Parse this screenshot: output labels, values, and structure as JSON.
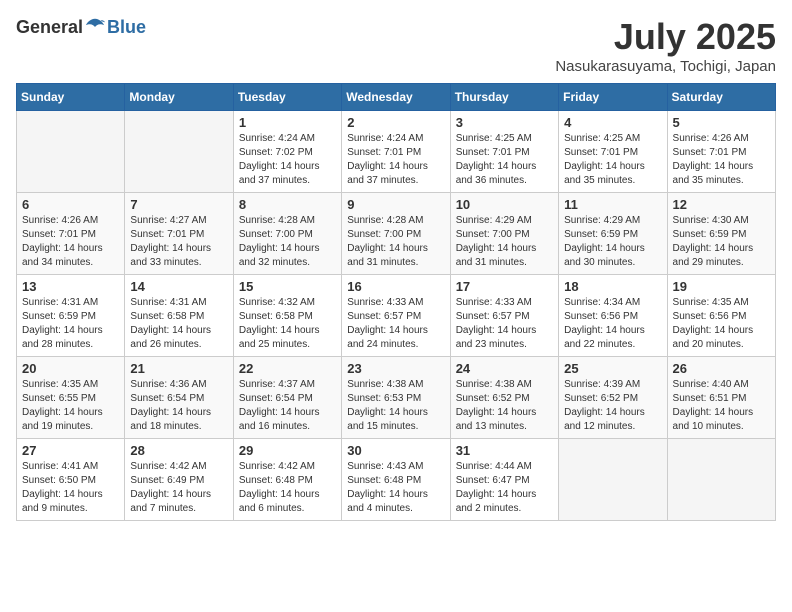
{
  "header": {
    "logo_general": "General",
    "logo_blue": "Blue",
    "month_title": "July 2025",
    "location": "Nasukarasuyama, Tochigi, Japan"
  },
  "weekdays": [
    "Sunday",
    "Monday",
    "Tuesday",
    "Wednesday",
    "Thursday",
    "Friday",
    "Saturday"
  ],
  "weeks": [
    [
      {
        "day": "",
        "detail": ""
      },
      {
        "day": "",
        "detail": ""
      },
      {
        "day": "1",
        "detail": "Sunrise: 4:24 AM\nSunset: 7:02 PM\nDaylight: 14 hours\nand 37 minutes."
      },
      {
        "day": "2",
        "detail": "Sunrise: 4:24 AM\nSunset: 7:01 PM\nDaylight: 14 hours\nand 37 minutes."
      },
      {
        "day": "3",
        "detail": "Sunrise: 4:25 AM\nSunset: 7:01 PM\nDaylight: 14 hours\nand 36 minutes."
      },
      {
        "day": "4",
        "detail": "Sunrise: 4:25 AM\nSunset: 7:01 PM\nDaylight: 14 hours\nand 35 minutes."
      },
      {
        "day": "5",
        "detail": "Sunrise: 4:26 AM\nSunset: 7:01 PM\nDaylight: 14 hours\nand 35 minutes."
      }
    ],
    [
      {
        "day": "6",
        "detail": "Sunrise: 4:26 AM\nSunset: 7:01 PM\nDaylight: 14 hours\nand 34 minutes."
      },
      {
        "day": "7",
        "detail": "Sunrise: 4:27 AM\nSunset: 7:01 PM\nDaylight: 14 hours\nand 33 minutes."
      },
      {
        "day": "8",
        "detail": "Sunrise: 4:28 AM\nSunset: 7:00 PM\nDaylight: 14 hours\nand 32 minutes."
      },
      {
        "day": "9",
        "detail": "Sunrise: 4:28 AM\nSunset: 7:00 PM\nDaylight: 14 hours\nand 31 minutes."
      },
      {
        "day": "10",
        "detail": "Sunrise: 4:29 AM\nSunset: 7:00 PM\nDaylight: 14 hours\nand 31 minutes."
      },
      {
        "day": "11",
        "detail": "Sunrise: 4:29 AM\nSunset: 6:59 PM\nDaylight: 14 hours\nand 30 minutes."
      },
      {
        "day": "12",
        "detail": "Sunrise: 4:30 AM\nSunset: 6:59 PM\nDaylight: 14 hours\nand 29 minutes."
      }
    ],
    [
      {
        "day": "13",
        "detail": "Sunrise: 4:31 AM\nSunset: 6:59 PM\nDaylight: 14 hours\nand 28 minutes."
      },
      {
        "day": "14",
        "detail": "Sunrise: 4:31 AM\nSunset: 6:58 PM\nDaylight: 14 hours\nand 26 minutes."
      },
      {
        "day": "15",
        "detail": "Sunrise: 4:32 AM\nSunset: 6:58 PM\nDaylight: 14 hours\nand 25 minutes."
      },
      {
        "day": "16",
        "detail": "Sunrise: 4:33 AM\nSunset: 6:57 PM\nDaylight: 14 hours\nand 24 minutes."
      },
      {
        "day": "17",
        "detail": "Sunrise: 4:33 AM\nSunset: 6:57 PM\nDaylight: 14 hours\nand 23 minutes."
      },
      {
        "day": "18",
        "detail": "Sunrise: 4:34 AM\nSunset: 6:56 PM\nDaylight: 14 hours\nand 22 minutes."
      },
      {
        "day": "19",
        "detail": "Sunrise: 4:35 AM\nSunset: 6:56 PM\nDaylight: 14 hours\nand 20 minutes."
      }
    ],
    [
      {
        "day": "20",
        "detail": "Sunrise: 4:35 AM\nSunset: 6:55 PM\nDaylight: 14 hours\nand 19 minutes."
      },
      {
        "day": "21",
        "detail": "Sunrise: 4:36 AM\nSunset: 6:54 PM\nDaylight: 14 hours\nand 18 minutes."
      },
      {
        "day": "22",
        "detail": "Sunrise: 4:37 AM\nSunset: 6:54 PM\nDaylight: 14 hours\nand 16 minutes."
      },
      {
        "day": "23",
        "detail": "Sunrise: 4:38 AM\nSunset: 6:53 PM\nDaylight: 14 hours\nand 15 minutes."
      },
      {
        "day": "24",
        "detail": "Sunrise: 4:38 AM\nSunset: 6:52 PM\nDaylight: 14 hours\nand 13 minutes."
      },
      {
        "day": "25",
        "detail": "Sunrise: 4:39 AM\nSunset: 6:52 PM\nDaylight: 14 hours\nand 12 minutes."
      },
      {
        "day": "26",
        "detail": "Sunrise: 4:40 AM\nSunset: 6:51 PM\nDaylight: 14 hours\nand 10 minutes."
      }
    ],
    [
      {
        "day": "27",
        "detail": "Sunrise: 4:41 AM\nSunset: 6:50 PM\nDaylight: 14 hours\nand 9 minutes."
      },
      {
        "day": "28",
        "detail": "Sunrise: 4:42 AM\nSunset: 6:49 PM\nDaylight: 14 hours\nand 7 minutes."
      },
      {
        "day": "29",
        "detail": "Sunrise: 4:42 AM\nSunset: 6:48 PM\nDaylight: 14 hours\nand 6 minutes."
      },
      {
        "day": "30",
        "detail": "Sunrise: 4:43 AM\nSunset: 6:48 PM\nDaylight: 14 hours\nand 4 minutes."
      },
      {
        "day": "31",
        "detail": "Sunrise: 4:44 AM\nSunset: 6:47 PM\nDaylight: 14 hours\nand 2 minutes."
      },
      {
        "day": "",
        "detail": ""
      },
      {
        "day": "",
        "detail": ""
      }
    ]
  ]
}
